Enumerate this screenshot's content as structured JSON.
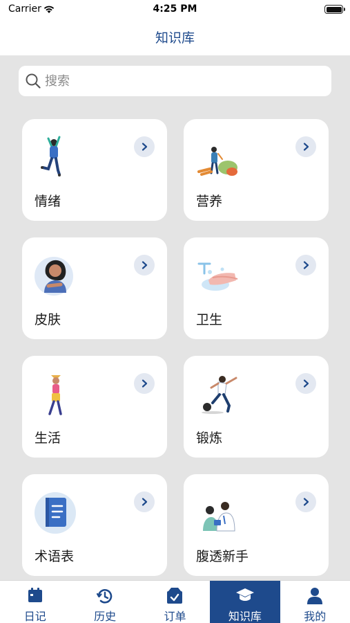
{
  "status_bar": {
    "carrier": "Carrier",
    "time": "4:25 PM"
  },
  "nav": {
    "title": "知识库"
  },
  "search": {
    "placeholder": "搜索"
  },
  "cards": [
    {
      "label": "情绪",
      "icon": "jumping-person-illustration"
    },
    {
      "label": "营养",
      "icon": "vegetables-illustration"
    },
    {
      "label": "皮肤",
      "icon": "woman-skin-illustration"
    },
    {
      "label": "卫生",
      "icon": "hand-washing-illustration"
    },
    {
      "label": "生活",
      "icon": "walking-woman-illustration"
    },
    {
      "label": "锻炼",
      "icon": "soccer-player-illustration"
    },
    {
      "label": "术语表",
      "icon": "book-illustration"
    },
    {
      "label": "腹透新手",
      "icon": "doctor-patient-illustration"
    }
  ],
  "tabs": [
    {
      "label": "日记",
      "icon": "calendar-icon",
      "active": false
    },
    {
      "label": "历史",
      "icon": "history-clock-icon",
      "active": false
    },
    {
      "label": "订单",
      "icon": "order-box-icon",
      "active": false
    },
    {
      "label": "知识库",
      "icon": "graduation-cap-icon",
      "active": true
    },
    {
      "label": "我的",
      "icon": "person-icon",
      "active": false
    }
  ],
  "colors": {
    "primary": "#1e4a8c",
    "background": "#e4e4e4",
    "card": "#ffffff",
    "arrow_bg": "#e3e8f1"
  }
}
